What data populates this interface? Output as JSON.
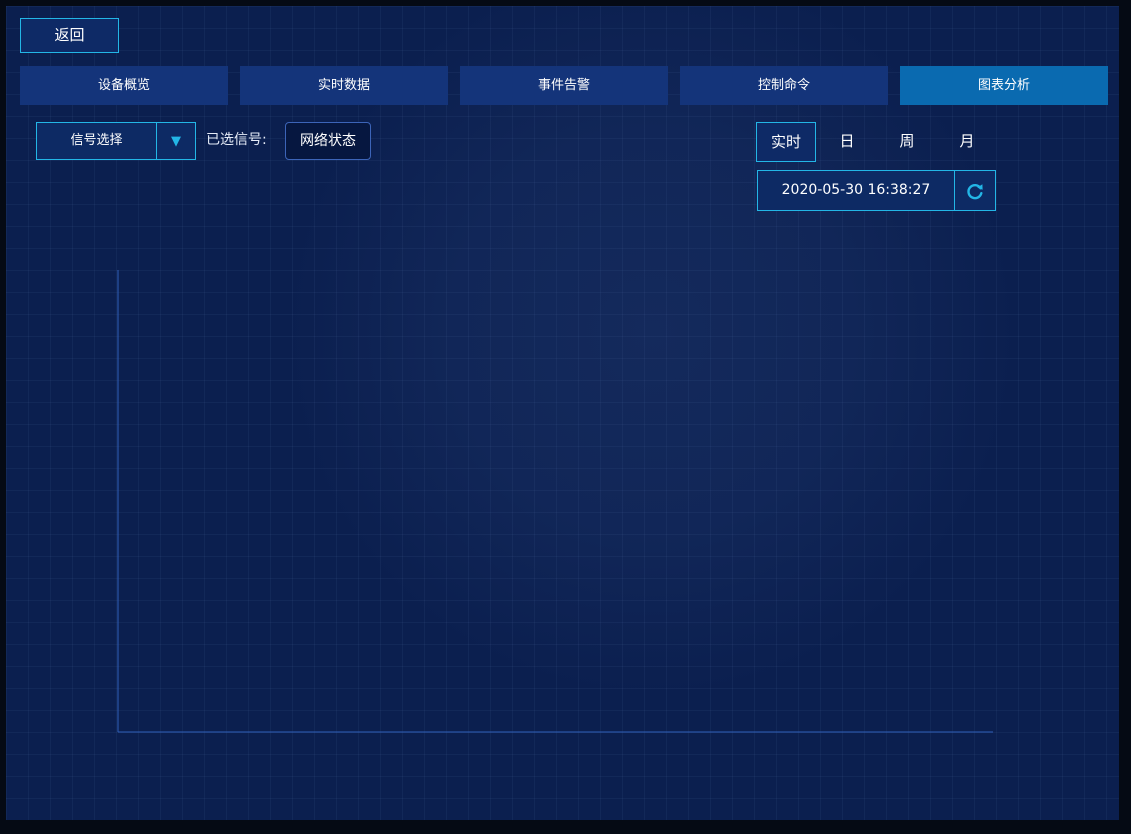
{
  "header": {
    "back_label": "返回"
  },
  "tabs": [
    {
      "label": "设备概览",
      "active": false
    },
    {
      "label": "实时数据",
      "active": false
    },
    {
      "label": "事件告警",
      "active": false
    },
    {
      "label": "控制命令",
      "active": false
    },
    {
      "label": "图表分析",
      "active": true
    }
  ],
  "signal": {
    "select_label": "信号选择",
    "selected_prefix": "已选信号:",
    "selected_value": "网络状态"
  },
  "range": {
    "options": [
      "实时",
      "日",
      "周",
      "月"
    ],
    "active": "实时"
  },
  "datetime": {
    "value": "2020-05-30 16:38:27"
  },
  "icons": {
    "dropdown": "caret-down-icon",
    "refresh": "refresh-icon"
  },
  "colors": {
    "accent": "#23b6e6",
    "tab": "#14347a",
    "tab_active": "#0a6ab0",
    "background": "#0b1f4f"
  },
  "chart_data": {
    "type": "line",
    "series": [],
    "title": "",
    "xlabel": "",
    "ylabel": ""
  }
}
